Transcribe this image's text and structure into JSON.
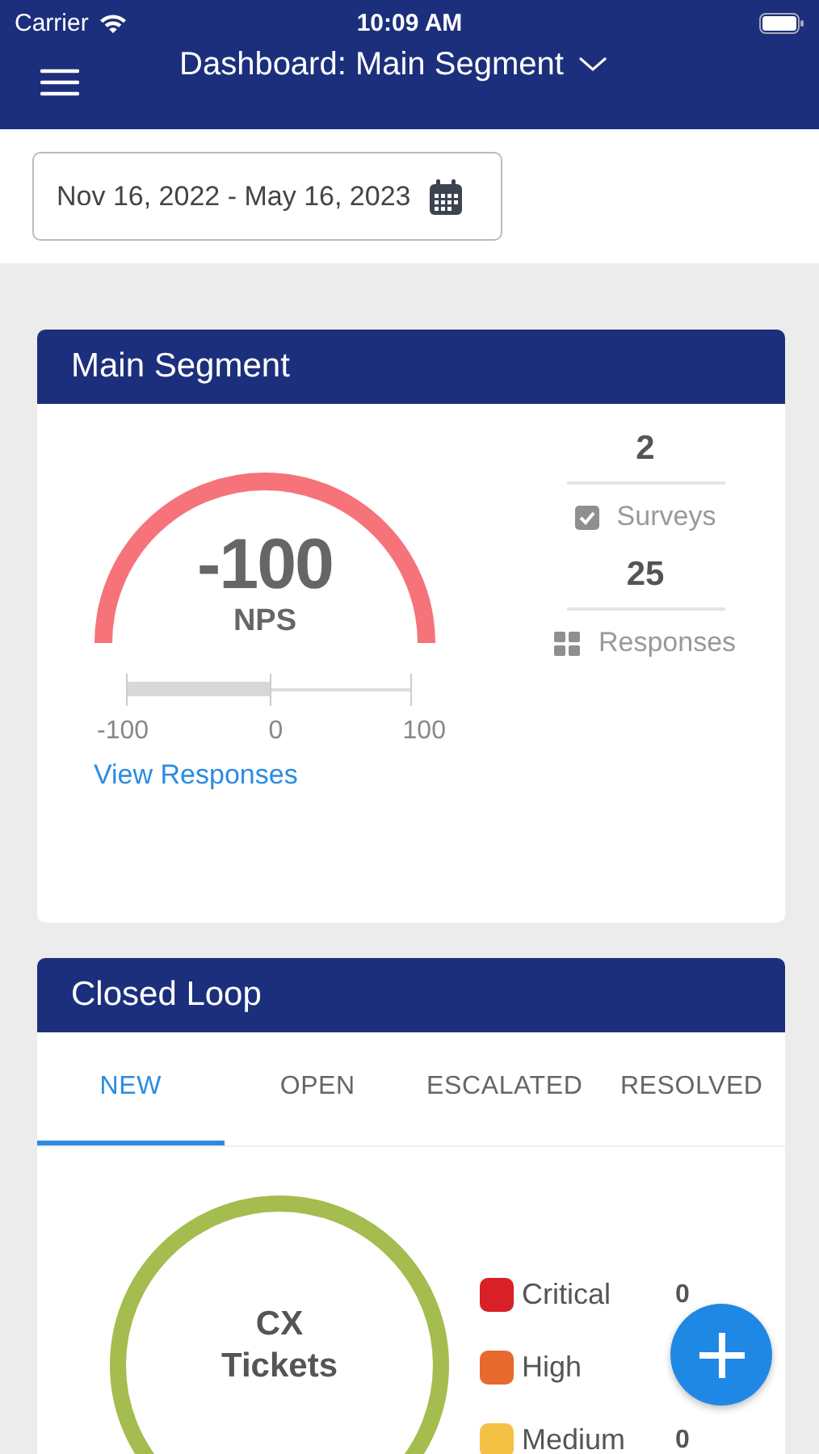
{
  "status_bar": {
    "carrier": "Carrier",
    "time": "10:09 AM"
  },
  "nav": {
    "title": "Dashboard: Main Segment"
  },
  "date_range": {
    "value": "Nov 16, 2022 - May 16, 2023"
  },
  "nps_card": {
    "title": "Main Segment",
    "score": "-100",
    "score_label": "NPS",
    "scale": {
      "level": 0.5,
      "labels": [
        "-100",
        "0",
        "100"
      ]
    },
    "link": "View Responses",
    "stats": [
      {
        "kind": "surveys",
        "value": "2",
        "label": "Surveys"
      },
      {
        "kind": "responses",
        "value": "25",
        "label": "Responses"
      }
    ]
  },
  "closed_loop": {
    "title": "Closed Loop",
    "tabs": [
      {
        "label": "NEW",
        "selected": true
      },
      {
        "label": "OPEN",
        "selected": false
      },
      {
        "label": "ESCALATED",
        "selected": false
      },
      {
        "label": "RESOLVED",
        "selected": false
      }
    ],
    "ring_label": "CX\nTickets",
    "legend": [
      {
        "label": "Critical",
        "color": "#d92027",
        "count": "0"
      },
      {
        "label": "High",
        "color": "#e8692d"
      },
      {
        "label": "Medium",
        "color": "#f4c043",
        "count": "0"
      }
    ]
  }
}
